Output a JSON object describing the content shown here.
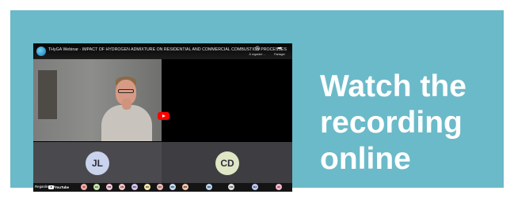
{
  "colors": {
    "banner_bg": "#6bbac9",
    "headline": "#ffffff",
    "youtube_red": "#ff0000"
  },
  "headline": {
    "line1": "Watch the",
    "line2": "recording",
    "line3": "online"
  },
  "video": {
    "title": "THyGA Webinar - IMPACT OF HYDROGEN ADMIXTURE ON RESIDENTIAL AND COMMERCIAL COMBUSTION PROCESSES",
    "channel_icon": "thyga-logo-icon",
    "actions": [
      {
        "icon": "clock-icon",
        "label": "À regarder ..."
      },
      {
        "icon": "share-icon",
        "label": "Partager"
      }
    ],
    "participants": [
      {
        "initials": "JL",
        "color": "#c9d3ec"
      },
      {
        "initials": "CD",
        "color": "#dfe6c6"
      }
    ],
    "watch_on": "Regarder sur",
    "youtube_word": "YouTube",
    "bottom_strip": [
      {
        "initials": "SI",
        "color": "#f4a6a6"
      },
      {
        "initials": "GC",
        "color": "#c8e6b0"
      },
      {
        "initials": "PM",
        "color": "#f8c8d8"
      },
      {
        "initials": "AN",
        "color": "#f4c2c2"
      },
      {
        "initials": "MG",
        "color": "#d7c4f0"
      },
      {
        "initials": "OD",
        "color": "#f6e6a8"
      },
      {
        "initials": "OC",
        "color": "#f2b8b8"
      },
      {
        "initials": "MK",
        "color": "#c4d8f4"
      },
      {
        "initials": "MR",
        "color": "#f6c4a8"
      },
      {
        "initials": "BK",
        "color": "#b8d4f0"
      },
      {
        "initials": "GM",
        "color": "#e0e0e0"
      },
      {
        "initials": "MJ",
        "color": "#b8c8f4"
      },
      {
        "initials": "AF",
        "color": "#f4b8c8"
      }
    ]
  }
}
